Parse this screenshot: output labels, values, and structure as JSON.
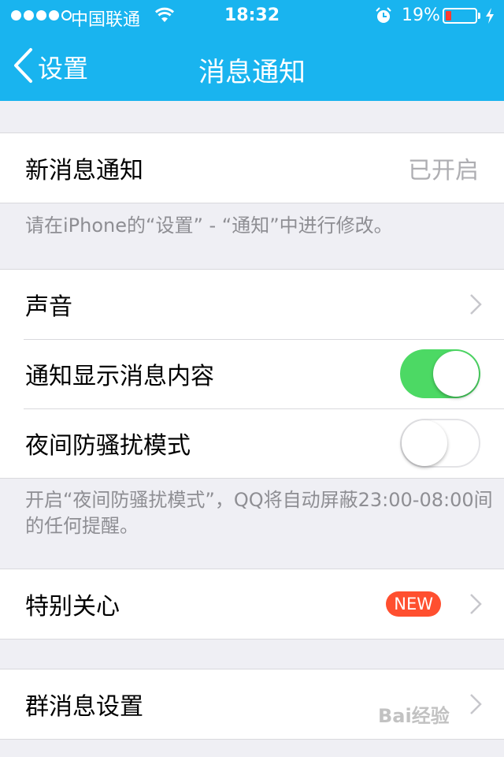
{
  "status_bar": {
    "carrier": "中国联通",
    "time": "18:32",
    "battery_percent": "19%",
    "battery_level": 0.19,
    "icons": [
      "signal-dots",
      "wifi-icon",
      "alarm-icon",
      "battery-icon",
      "charging-bolt-icon"
    ]
  },
  "navbar": {
    "back_label": "设置",
    "title": "消息通知"
  },
  "section_notify": {
    "row_label": "新消息通知",
    "row_value": "已开启",
    "note": "请在iPhone的“设置” - “通知”中进行修改。"
  },
  "section_options": {
    "sound_label": "声音",
    "show_content_label": "通知显示消息内容",
    "show_content_on": true,
    "night_mode_label": "夜间防骚扰模式",
    "night_mode_on": false,
    "note": "开启“夜间防骚扰模式”，QQ将自动屏蔽23:00-08:00间的任何提醒。"
  },
  "section_special": {
    "label": "特别关心",
    "badge": "NEW"
  },
  "section_group": {
    "label": "群消息设置"
  },
  "watermark": "Bai经验",
  "colors": {
    "header": "#19b4ef",
    "toggle_on": "#4cd964",
    "badge": "#ff4f2f",
    "battery_low": "#ff3b30"
  }
}
